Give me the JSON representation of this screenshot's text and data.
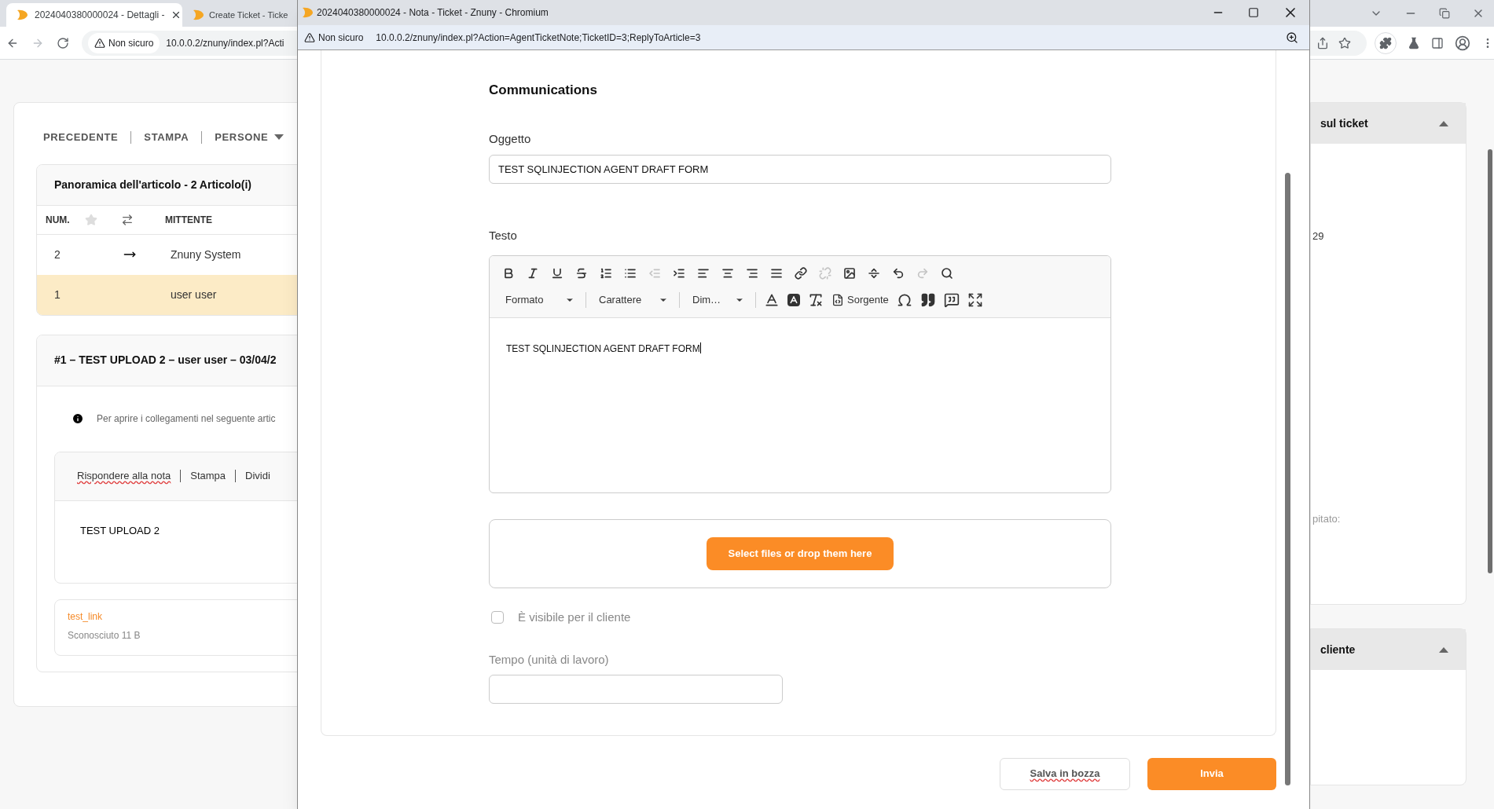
{
  "browser": {
    "tabs": [
      {
        "title": "2024040380000024 - Dettagli -",
        "selected": true
      },
      {
        "title": "Create Ticket - Ticke",
        "selected": false
      }
    ],
    "security": "Non sicuro",
    "url": "10.0.0.2/znuny/index.pl?Acti"
  },
  "ticket_page": {
    "nav": [
      "PRECEDENTE",
      "STAMPA",
      "PERSONE"
    ],
    "overview": {
      "title": "Panoramica dell'articolo - 2 Articolo(i)",
      "columns": [
        "NUM.",
        "MITTENTE"
      ],
      "rows": [
        {
          "num": "2",
          "sender": "Znuny System",
          "selected": false
        },
        {
          "num": "1",
          "sender": "user user",
          "selected": true
        }
      ]
    },
    "article": {
      "title": "#1 – TEST UPLOAD 2 – user user – 03/04/2",
      "notice": "Per aprire i collegamenti nel seguente artic",
      "actions": [
        "Rispondere alla nota",
        "Stampa",
        "Dividi"
      ],
      "body": "TEST UPLOAD 2",
      "attachment": {
        "name": "test_link",
        "info": "Sconosciuto 11 B"
      }
    }
  },
  "sidebar": [
    {
      "title": "sul ticket",
      "expanded": true,
      "lines": [
        "29",
        "pitato:"
      ]
    },
    {
      "title": "cliente",
      "expanded": true
    }
  ],
  "popup": {
    "title": "2024040380000024 - Nota - Ticket - Znuny - Chromium",
    "security": "Non sicuro",
    "url": "10.0.0.2/znuny/index.pl?Action=AgentTicketNote;TicketID=3;ReplyToArticle=3",
    "section": "Communications",
    "subject_label": "Oggetto",
    "subject_value": "TEST SQLINJECTION AGENT DRAFT FORM",
    "body_label": "Testo",
    "toolbar_row1": [
      {
        "disabled": false
      },
      {
        "disabled": false
      },
      {
        "disabled": false
      },
      {
        "disabled": false
      },
      {
        "disabled": false
      },
      {
        "disabled": false
      },
      {
        "disabled": true
      },
      {
        "disabled": false
      },
      {
        "disabled": false
      },
      {
        "disabled": false
      },
      {
        "disabled": false
      },
      {
        "disabled": false
      },
      {
        "disabled": false
      },
      {
        "disabled": true
      },
      {
        "disabled": false
      },
      {
        "disabled": false
      },
      {
        "disabled": false
      },
      {
        "disabled": true
      },
      {
        "disabled": false
      }
    ],
    "dropdowns": [
      "Formato",
      "Carattere",
      "Dim…"
    ],
    "source_label": "Sorgente",
    "body_value": "TEST SQLINJECTION AGENT DRAFT FORM",
    "upload_button": "Select files or drop them here",
    "visible_to_customer": {
      "label": "È visibile per il cliente",
      "checked": false
    },
    "time_label": "Tempo (unità di lavoro)",
    "buttons": {
      "draft": "Salva in bozza",
      "send": "Invia"
    }
  }
}
